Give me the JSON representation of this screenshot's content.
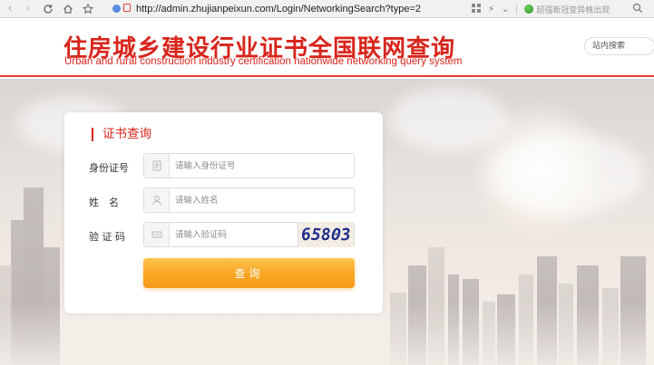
{
  "browser": {
    "url": "http://admin.zhujianpeixun.com/Login/NetworkingSearch?type=2",
    "news_text": "超强新冠变异株出现"
  },
  "header": {
    "title_cn": "住房城乡建设行业证书全国联网查询",
    "title_en": "Urban and rural construction industry certification nationwide networking query system",
    "site_search_placeholder": "站内搜索"
  },
  "form": {
    "title": "证书查询",
    "id_label": "身份证号",
    "id_placeholder": "请输入身份证号",
    "name_label": "姓　名",
    "name_placeholder": "请输入姓名",
    "captcha_label": "验 证 码",
    "captcha_placeholder": "请输入验证码",
    "captcha_digits": [
      "6",
      "5",
      "8",
      "0",
      "3"
    ],
    "submit_label": "查询"
  },
  "colors": {
    "brand_red": "#d8251c",
    "button_orange": "#fba524",
    "captcha_blue": "#1f2e8a"
  },
  "icons": {
    "back": "arrow-left-icon",
    "forward": "arrow-right-icon",
    "refresh": "refresh-icon",
    "home": "home-icon",
    "bookmark": "star-icon",
    "id": "id-card-icon",
    "name": "user-icon",
    "captcha": "keyboard-icon"
  }
}
